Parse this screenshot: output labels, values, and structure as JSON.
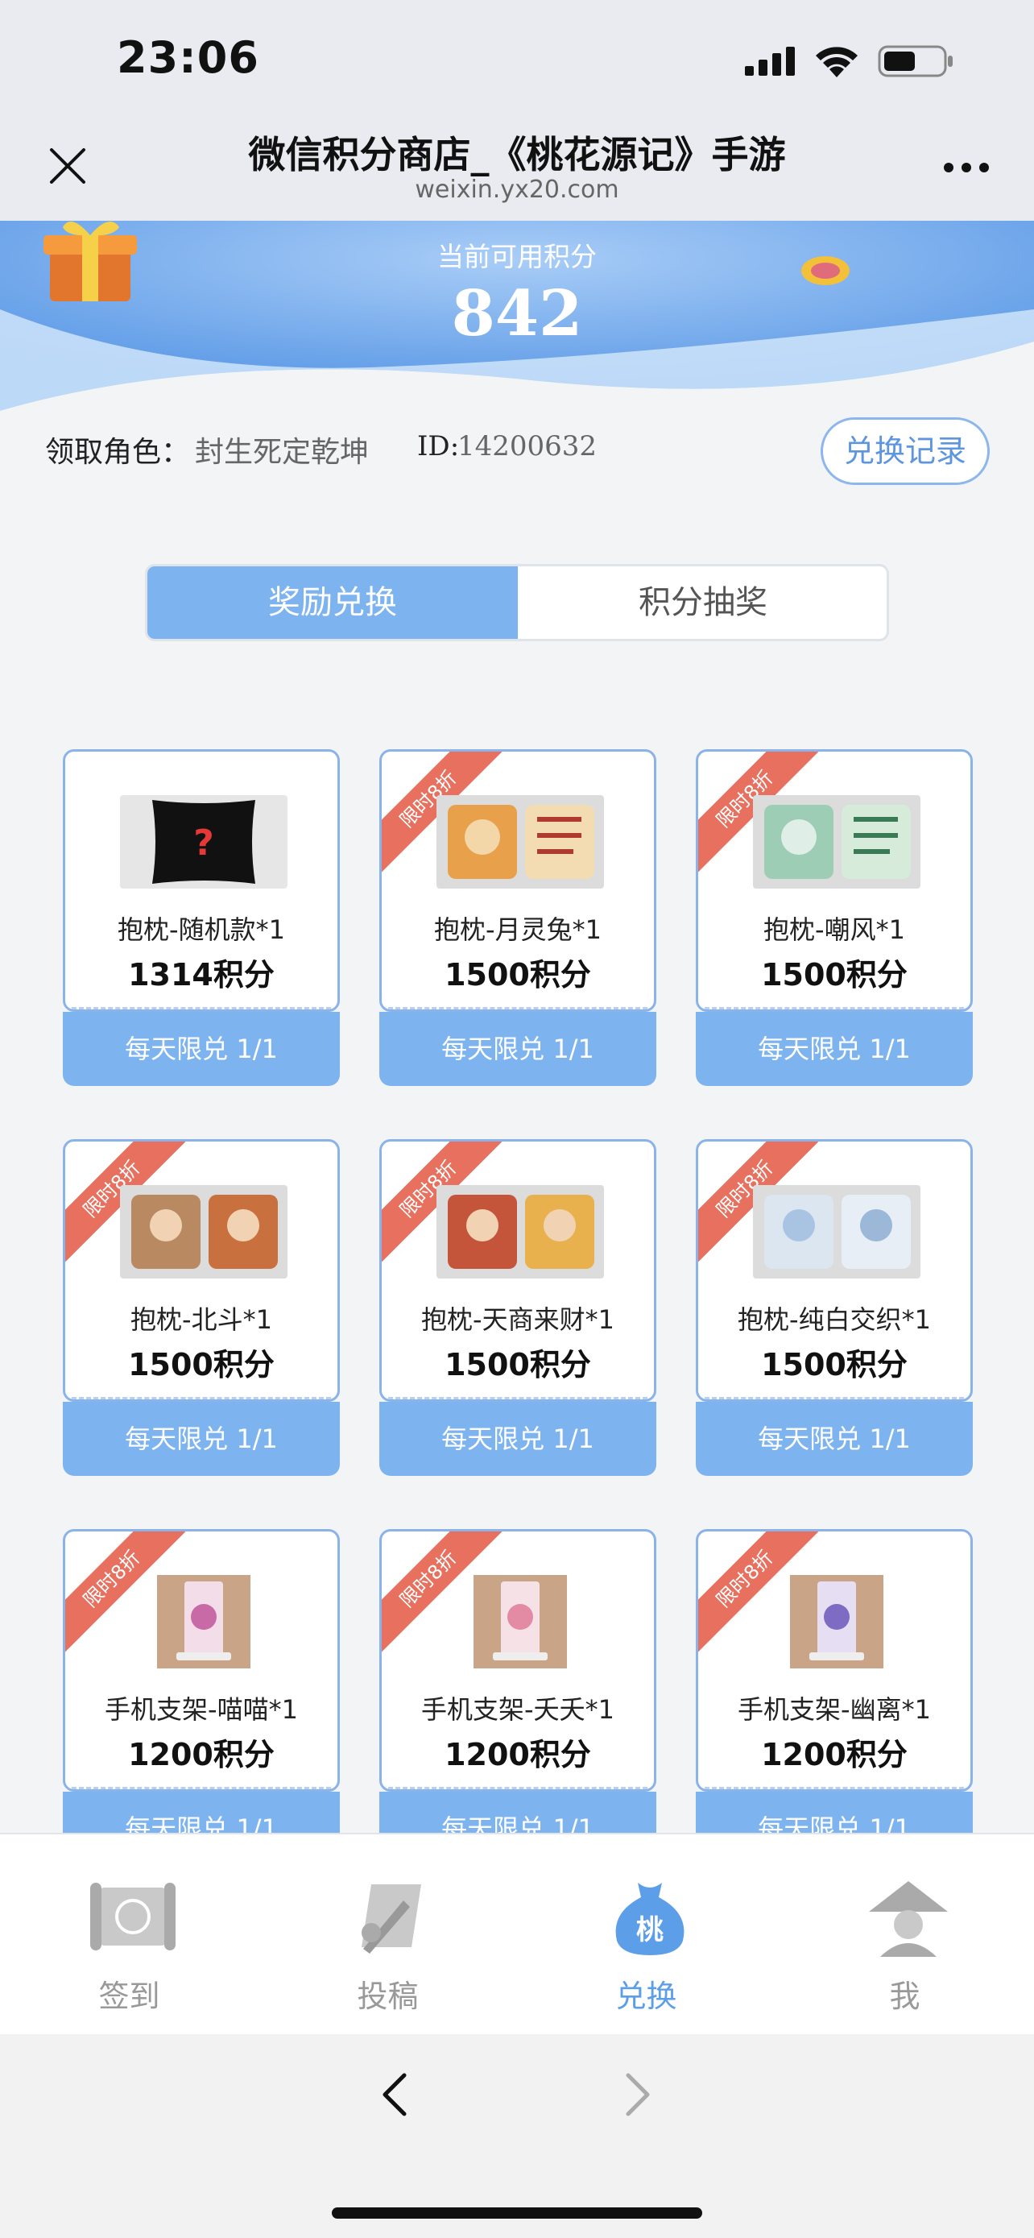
{
  "status": {
    "time": "23:06"
  },
  "nav": {
    "title": "微信积分商店_《桃花源记》手游",
    "subtitle": "weixin.yx20.com"
  },
  "banner": {
    "label": "当前可用积分",
    "points": "842"
  },
  "role": {
    "label": "领取角色：",
    "name": "封生死定乾坤",
    "id_label": "ID:",
    "id_value": "14200632",
    "history_button": "兑换记录"
  },
  "tabs": [
    {
      "label": "奖励兑换",
      "active": true
    },
    {
      "label": "积分抽奖",
      "active": false
    }
  ],
  "ribbon_text": "限时8折",
  "products": [
    {
      "name": "抱枕-随机款*1",
      "price": "1314积分",
      "limit": "每天限兑  1/1",
      "discount": false,
      "image": "pillow-random"
    },
    {
      "name": "抱枕-月灵兔*1",
      "price": "1500积分",
      "limit": "每天限兑  1/1",
      "discount": true,
      "image": "pillow-pair-orange"
    },
    {
      "name": "抱枕-嘲风*1",
      "price": "1500积分",
      "limit": "每天限兑  1/1",
      "discount": true,
      "image": "pillow-pair-green"
    },
    {
      "name": "抱枕-北斗*1",
      "price": "1500积分",
      "limit": "每天限兑  1/1",
      "discount": true,
      "image": "pillow-pair-brown"
    },
    {
      "name": "抱枕-天商来财*1",
      "price": "1500积分",
      "limit": "每天限兑  1/1",
      "discount": true,
      "image": "pillow-pair-red"
    },
    {
      "name": "抱枕-纯白交织*1",
      "price": "1500积分",
      "limit": "每天限兑  1/1",
      "discount": true,
      "image": "pillow-pair-white"
    },
    {
      "name": "手机支架-喵喵*1",
      "price": "1200积分",
      "limit": "每天限兑  1/1",
      "discount": true,
      "image": "phone-stand-pink"
    },
    {
      "name": "手机支架-夭夭*1",
      "price": "1200积分",
      "limit": "每天限兑  1/1",
      "discount": true,
      "image": "phone-stand-peach"
    },
    {
      "name": "手机支架-幽离*1",
      "price": "1200积分",
      "limit": "每天限兑  1/1",
      "discount": true,
      "image": "phone-stand-purple"
    }
  ],
  "tabbar": [
    {
      "label": "签到",
      "icon": "scroll-sign-icon",
      "active": false
    },
    {
      "label": "投稿",
      "icon": "quill-scroll-icon",
      "active": false
    },
    {
      "label": "兑换",
      "icon": "peach-bag-icon",
      "active": true,
      "glyph": "桃"
    },
    {
      "label": "我",
      "icon": "straw-hat-person-icon",
      "active": false
    }
  ],
  "colors": {
    "accent": "#7db4ef",
    "ribbon": "#e8705e",
    "active_text": "#5d9ee8"
  }
}
